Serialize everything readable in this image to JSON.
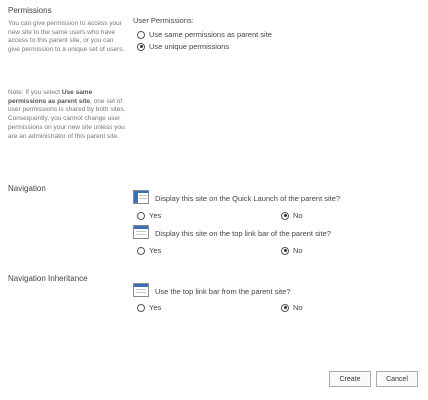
{
  "permissions": {
    "title": "Permissions",
    "desc_1": "You can give permission to access your new site to the same users who have access to this parent site, or you can give permission to a unique set of users.",
    "note_prefix": "Note: If you select ",
    "note_bold": "Use same permissions as parent site",
    "note_suffix": ", one set of user permissions is shared by both sites. Consequently, you cannot change user permissions on your new site unless you are an administrator of this parent site.",
    "field_label": "User Permissions:",
    "options": [
      {
        "label": "Use same permissions as parent site",
        "checked": false
      },
      {
        "label": "Use unique permissions",
        "checked": true
      }
    ]
  },
  "navigation": {
    "title": "Navigation",
    "quick_launch_question": "Display this site on the Quick Launch of the parent site?",
    "quick_launch_icon": "quick-launch-icon",
    "top_link_question": "Display this site on the top link bar of the parent site?",
    "top_link_icon": "top-link-bar-icon",
    "yes_label": "Yes",
    "no_label": "No",
    "quick_launch_value": "No",
    "top_link_value": "No"
  },
  "navigation_inheritance": {
    "title": "Navigation Inheritance",
    "question": "Use the top link bar from the parent site?",
    "icon": "top-link-bar-icon",
    "yes_label": "Yes",
    "no_label": "No",
    "value": "No"
  },
  "buttons": {
    "create": "Create",
    "cancel": "Cancel"
  }
}
